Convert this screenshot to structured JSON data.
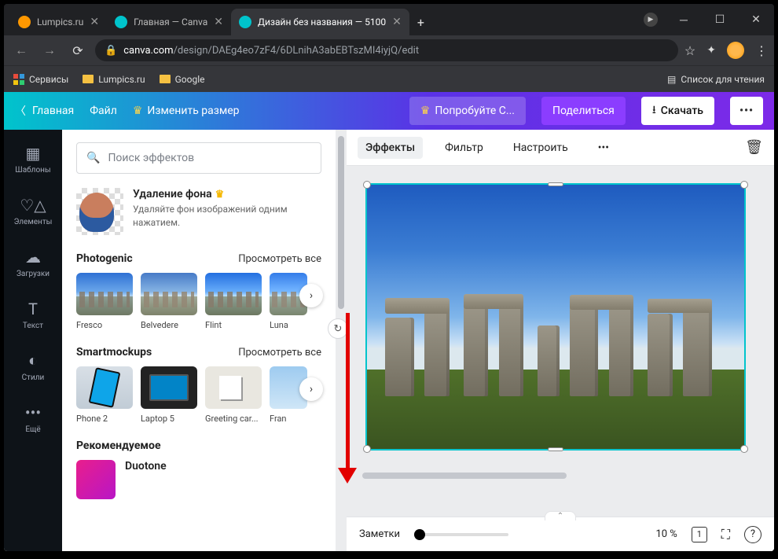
{
  "browser": {
    "tabs": [
      {
        "title": "Lumpics.ru",
        "favcolor": "#ff9800"
      },
      {
        "title": "Главная — Canva",
        "favcolor": "#00c4cc"
      },
      {
        "title": "Дизайн без названия — 5100",
        "favcolor": "#00c4cc"
      }
    ],
    "url_domain": "canva.com",
    "url_path": "/design/DAEg4eo7zF4/6DLnihA3abEBTszMI4iyjQ/edit",
    "bookmarks": {
      "apps": "Сервисы",
      "b1": "Lumpics.ru",
      "b2": "Google",
      "reading": "Список для чтения"
    }
  },
  "header": {
    "home": "Главная",
    "file": "Файл",
    "resize": "Изменить размер",
    "try": "Попробуйте С...",
    "share": "Поделиться",
    "download": "Скачать"
  },
  "rail": {
    "templates": "Шаблоны",
    "elements": "Элементы",
    "uploads": "Загрузки",
    "text": "Текст",
    "styles": "Стили",
    "more": "Ещё"
  },
  "panel": {
    "search_placeholder": "Поиск эффектов",
    "feature_title": "Удаление фона",
    "feature_desc": "Удаляйте фон изображений одним нажатием.",
    "view_all": "Просмотреть все",
    "sections": {
      "photogenic": {
        "name": "Photogenic",
        "items": [
          "Fresco",
          "Belvedere",
          "Flint",
          "Luna"
        ]
      },
      "smartmockups": {
        "name": "Smartmockups",
        "items": [
          "Phone 2",
          "Laptop 5",
          "Greeting car...",
          "Fran"
        ]
      },
      "recommended": {
        "name": "Рекомендуемое",
        "item": "Duotone"
      }
    }
  },
  "toolbar": {
    "effects": "Эффекты",
    "filter": "Фильтр",
    "adjust": "Настроить"
  },
  "bottom": {
    "notes": "Заметки",
    "zoom": "10 %",
    "page": "1"
  }
}
